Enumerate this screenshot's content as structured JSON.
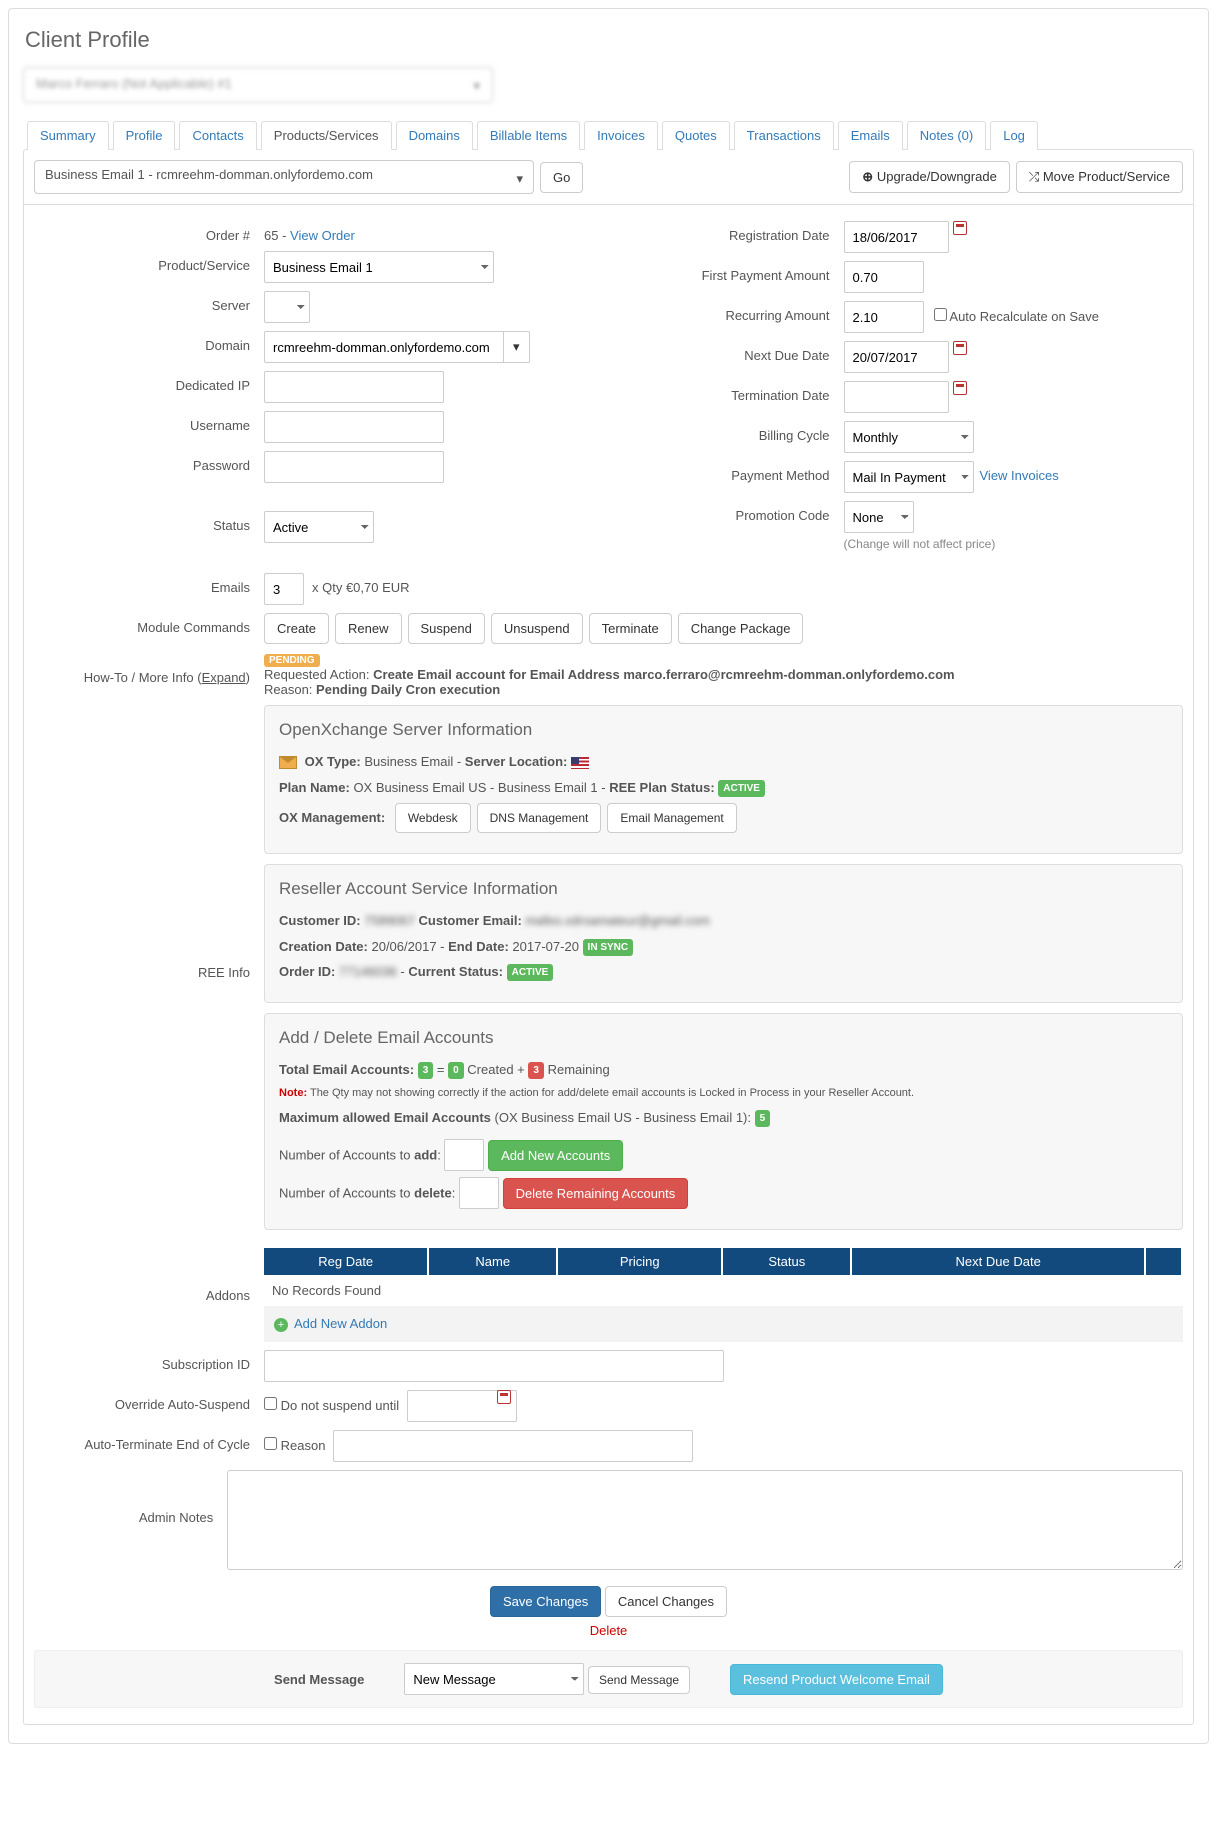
{
  "page_title": "Client Profile",
  "client_selected": "Marco Ferraro (Not Applicable)  #1",
  "tabs": [
    "Summary",
    "Profile",
    "Contacts",
    "Products/Services",
    "Domains",
    "Billable Items",
    "Invoices",
    "Quotes",
    "Transactions",
    "Emails",
    "Notes (0)",
    "Log"
  ],
  "active_tab_index": 3,
  "product_selected": "Business Email 1 - rcmreehm-domman.onlyfordemo.com",
  "go_label": "Go",
  "upgrade_label": "Upgrade/Downgrade",
  "move_label": "Move Product/Service",
  "left": {
    "order_label": "Order #",
    "order_value": "65",
    "view_order": "View Order",
    "product_label": "Product/Service",
    "product_value": "Business Email 1",
    "server_label": "Server",
    "server_value": "",
    "domain_label": "Domain",
    "domain_value": "rcmreehm-domman.onlyfordemo.com",
    "dedicated_ip_label": "Dedicated IP",
    "dedicated_ip_value": "",
    "username_label": "Username",
    "username_value": "",
    "password_label": "Password",
    "password_value": "",
    "status_label": "Status",
    "status_value": "Active",
    "emails_label": "Emails",
    "emails_qty": "3",
    "emails_suffix": "x Qty €0,70 EUR"
  },
  "right": {
    "reg_label": "Registration Date",
    "reg_value": "18/06/2017",
    "first_pay_label": "First Payment Amount",
    "first_pay_value": "0.70",
    "recurring_label": "Recurring Amount",
    "recurring_value": "2.10",
    "auto_recalc": "Auto Recalculate on Save",
    "next_due_label": "Next Due Date",
    "next_due_value": "20/07/2017",
    "term_label": "Termination Date",
    "term_value": "",
    "billing_label": "Billing Cycle",
    "billing_value": "Monthly",
    "payment_label": "Payment Method",
    "payment_value": "Mail In Payment",
    "view_invoices": "View Invoices",
    "promo_label": "Promotion Code",
    "promo_value": "None",
    "promo_note": "(Change will not affect price)"
  },
  "module_commands_label": "Module Commands",
  "module_commands": [
    "Create",
    "Renew",
    "Suspend",
    "Unsuspend",
    "Terminate",
    "Change Package"
  ],
  "howto_label": "How-To / More Info (",
  "howto_expand": "Expand",
  "howto_close": ")",
  "pending_badge": "PENDING",
  "requested_action_label": "Requested Action: ",
  "requested_action": "Create Email account for Email Address marco.ferraro@rcmreehm-domman.onlyfordemo.com",
  "reason_label": "Reason: ",
  "reason": "Pending Daily Cron execution",
  "ree_info_label": "REE Info",
  "ox": {
    "title": "OpenXchange Server Information",
    "type_label": "OX Type:",
    "type_value": "Business Email",
    "loc_label": "Server Location:",
    "plan_label": "Plan Name:",
    "plan_value": "OX Business Email US - Business Email 1",
    "status_label": "REE Plan Status:",
    "status_badge": "ACTIVE",
    "mgmt_label": "OX Management:",
    "mgmt_buttons": [
      "Webdesk",
      "DNS Management",
      "Email Management"
    ]
  },
  "reseller": {
    "title": "Reseller Account Service Information",
    "cust_id_label": "Customer ID:",
    "cust_id": "7589067",
    "cust_email_label": "Customer Email:",
    "cust_email": "mafeo.xdrsamateur@gmail.com",
    "creation_label": "Creation Date:",
    "creation": "20/06/2017",
    "end_label": "End Date:",
    "end": "2017-07-20",
    "sync_badge": "IN SYNC",
    "order_label": "Order ID:",
    "order": "77146036",
    "status_label": "Current Status:",
    "status_badge": "ACTIVE"
  },
  "email_acc": {
    "title": "Add / Delete Email Accounts",
    "total_label": "Total Email Accounts:",
    "total": "3",
    "eq": "=",
    "created": "0",
    "created_label": "Created",
    "plus": "+",
    "remaining": "3",
    "remaining_label": "Remaining",
    "note_prefix": "Note:",
    "note": "The Qty may not showing correctly if the action for add/delete email accounts is Locked in Process in your Reseller Account.",
    "max_label": "Maximum allowed Email Accounts",
    "max_plan": "(OX Business Email US - Business Email 1):",
    "max": "5",
    "add_label": "Number of Accounts to ",
    "add_bold": "add",
    "add_btn": "Add New Accounts",
    "del_label": "Number of Accounts to ",
    "del_bold": "delete",
    "del_btn": "Delete Remaining Accounts"
  },
  "addons_label": "Addons",
  "addons_headers": [
    "Reg Date",
    "Name",
    "Pricing",
    "Status",
    "Next Due Date",
    ""
  ],
  "addons_empty": "No Records Found",
  "add_addon": "Add New Addon",
  "sub_id_label": "Subscription ID",
  "suspend_label": "Override Auto-Suspend",
  "suspend_text": "Do not suspend until",
  "autoterm_label": "Auto-Terminate End of Cycle",
  "autoterm_text": "Reason",
  "notes_label": "Admin Notes",
  "save_btn": "Save Changes",
  "cancel_btn": "Cancel Changes",
  "delete_link": "Delete",
  "send_msg_label": "Send Message",
  "send_msg_select": "New Message",
  "send_msg_btn": "Send Message",
  "resend_btn": "Resend Product Welcome Email"
}
